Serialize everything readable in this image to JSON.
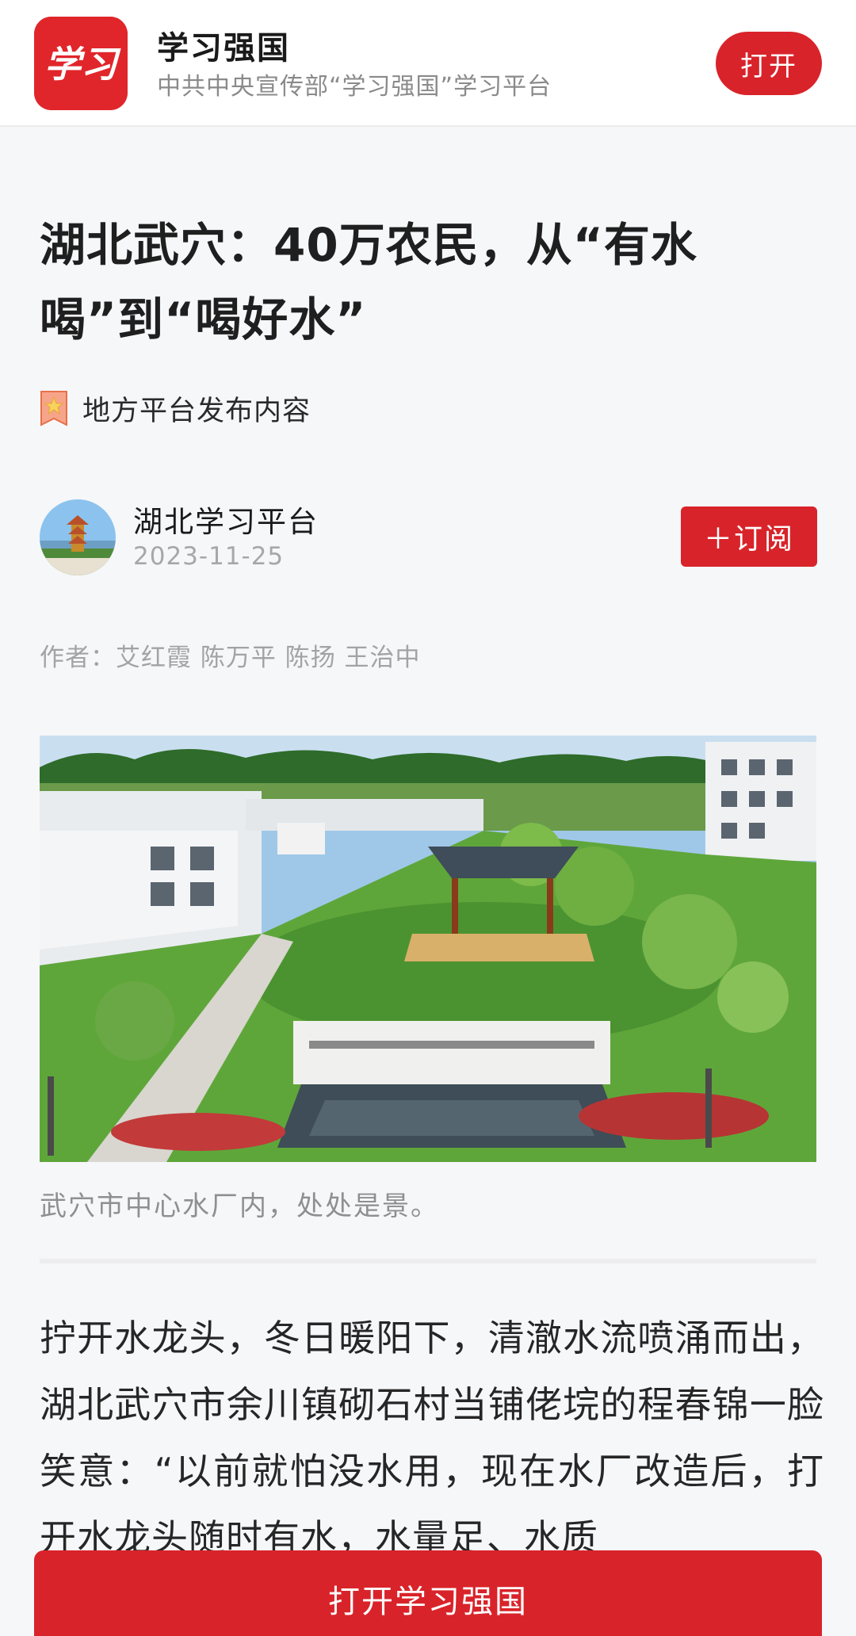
{
  "app_banner": {
    "logo_text": "学习",
    "app_name": "学习强国",
    "description": "中共中央宣传部“学习强国”学习平台",
    "open_label": "打开"
  },
  "article": {
    "title": "湖北武穴：40万农民，从“有水喝”到“喝好水”",
    "source_label": "地方平台发布内容",
    "publisher": "湖北学习平台",
    "date": "2023-11-25",
    "subscribe_label": "＋订阅",
    "authors": "作者：艾红霞 陈万平 陈扬 王治中",
    "photo_caption": "武穴市中心水厂内，处处是景。",
    "body": "拧开水龙头，冬日暖阳下，清澈水流喷涌而出，湖北武穴市余川镇砌石村当铺佬垸的程春锦一脸笑意：“以前就怕没水用，现在水厂改造后，打开水龙头随时有水，水量足、水质"
  },
  "bottom_cta": {
    "label": "打开学习强国"
  },
  "colors": {
    "brand_red": "#d9232a",
    "logo_red": "#e0262b",
    "page_bg": "#f6f7f9"
  },
  "icons": {
    "app_logo": "xuexi-logo-icon",
    "source_badge": "star-badge-icon",
    "publisher_avatar": "yellow-crane-tower-avatar"
  }
}
